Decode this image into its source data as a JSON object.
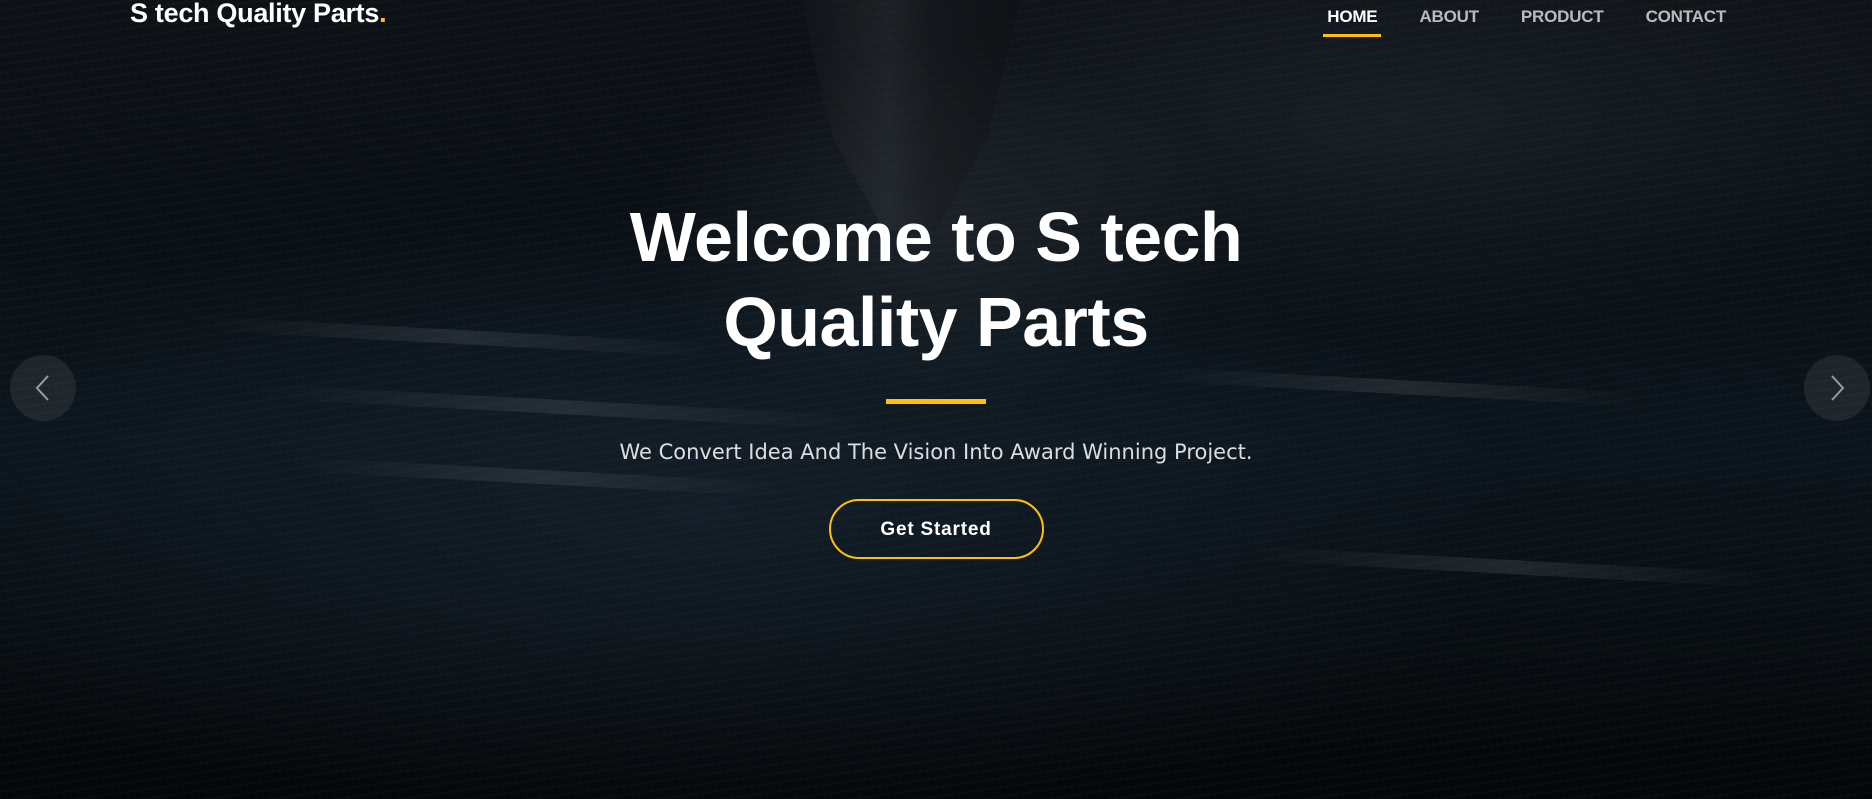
{
  "brand": {
    "name": "S tech Quality Parts",
    "dot": "."
  },
  "nav": {
    "items": [
      {
        "label": "HOME",
        "active": true
      },
      {
        "label": "ABOUT",
        "active": false
      },
      {
        "label": "PRODUCT",
        "active": false
      },
      {
        "label": "CONTACT",
        "active": false
      }
    ]
  },
  "hero": {
    "title_line1": "Welcome to S tech",
    "title_line2": "Quality Parts",
    "subtitle": "We Convert Idea And The Vision Into Award Winning Project.",
    "cta_label": "Get Started"
  },
  "carousel": {
    "prev_icon": "chevron-left-icon",
    "next_icon": "chevron-right-icon"
  },
  "colors": {
    "accent": "#ffc107",
    "text": "#ffffff"
  }
}
